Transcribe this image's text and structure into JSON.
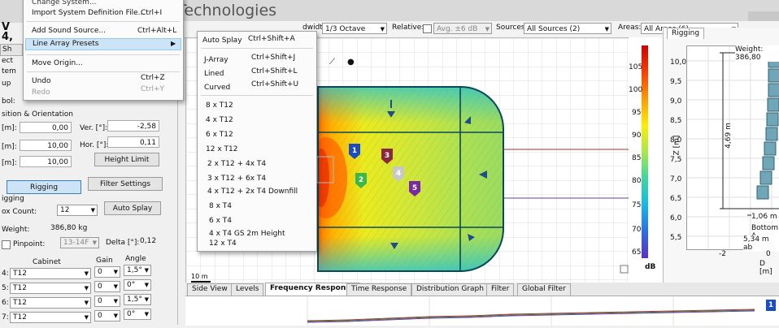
{
  "title_bar": {
    "app_title": "Technologies"
  },
  "toolbar": {
    "bandwidth_label": "dwidth:",
    "bandwidth_value": "1/3 Octave",
    "relative_label": "Relative:",
    "avg_value": "Avg. ±6 dB",
    "sources_label": "Sources:",
    "sources_value": "All Sources (2)",
    "areas_label": "Areas:",
    "areas_value": "All Areas (6)"
  },
  "file_menu": {
    "items": [
      {
        "label": "Change System...",
        "shortcut": ""
      },
      {
        "label": "Import System Definition File...",
        "shortcut": "Ctrl+I"
      },
      {
        "label": "Add Sound Source...",
        "shortcut": "Ctrl+Alt+L"
      },
      {
        "label": "Line Array Presets",
        "shortcut": ""
      },
      {
        "label": "Move Origin...",
        "shortcut": ""
      },
      {
        "label": "Undo",
        "shortcut": "Ctrl+Z"
      },
      {
        "label": "Redo",
        "shortcut": "Ctrl+Y"
      }
    ]
  },
  "presets_menu": {
    "shortcut_items": [
      {
        "label": "Auto Splay",
        "shortcut": "Ctrl+Shift+A"
      },
      {
        "label": "J-Array",
        "shortcut": "Ctrl+Shift+J"
      },
      {
        "label": "Lined",
        "shortcut": "Ctrl+Shift+L"
      },
      {
        "label": "Curved",
        "shortcut": "Ctrl+Shift+U"
      }
    ],
    "presets": [
      "8 x T12",
      "4 x T12",
      "6 x T12",
      "12 x T12",
      "2 x T12 + 4x T4",
      "3 x T12 + 6x T4",
      "4 x T12 + 2x T4 Downfill",
      "8 x T4",
      "6 x T4",
      "4 x T4 GS 2m Height",
      "12 x T4"
    ]
  },
  "left_panel": {
    "header_top": "V",
    "header_bottom": "4,",
    "tab_fragment": "Sh",
    "side_letters": [
      "ect",
      "tem",
      "up",
      "bol:"
    ],
    "section_title": "sition & Orientation",
    "rows": [
      {
        "label": "[m]:",
        "value": "0,00",
        "label2": "Ver. [°]:",
        "value2": "-2,58"
      },
      {
        "label": "[m]:",
        "value": "10,00",
        "label2": "Hor. [°]:",
        "value2": "0,11"
      },
      {
        "label": "[m]:",
        "value": "10,00",
        "button": "Height Limit"
      }
    ],
    "rigging_button": "Rigging",
    "filter_button": "Filter Settings",
    "rigging_section": "igging",
    "box_count_label": "ox Count:",
    "box_count_value": "12",
    "auto_splay_button": "Auto Splay",
    "weight_label": "Weight:",
    "weight_value": "386,80 kg",
    "pinpoint_label": "Pinpoint:",
    "pinpoint_value": "13-14F",
    "delta_label": "Delta [°]:",
    "delta_value": "0,12",
    "table_headers": [
      "Cabinet",
      "Gain",
      "Angle"
    ],
    "table_rows": [
      {
        "idx": "4:",
        "cabinet": "T12",
        "gain": "0",
        "angle": "1,5°"
      },
      {
        "idx": "5:",
        "cabinet": "T12",
        "gain": "0",
        "angle": "0°"
      },
      {
        "idx": "6:",
        "cabinet": "T12",
        "gain": "0",
        "angle": "1,5°"
      },
      {
        "idx": "7:",
        "cabinet": "T12",
        "gain": "0",
        "angle": "0°"
      }
    ]
  },
  "plot": {
    "scale_label": "10 m",
    "source_markers": [
      "1",
      "2",
      "3",
      "4",
      "5"
    ]
  },
  "colorbar": {
    "ticks": [
      "105",
      "100",
      "95",
      "90",
      "85",
      "80",
      "75",
      "70",
      "65"
    ],
    "unit": "dB",
    "gradient": [
      "#d00000",
      "#ff3b00",
      "#ff9900",
      "#ffee00",
      "#a8e84a",
      "#3cd8a0",
      "#15b8e8",
      "#2a6ee8",
      "#5a2fc8"
    ]
  },
  "rigging_panel": {
    "tab_label": "Rigging",
    "weight_text": "Weight: 386,80",
    "z_axis_label": "Z [m]",
    "y_ticks": [
      "10,0",
      "9,5",
      "9,0",
      "8,5",
      "8,0",
      "7,5",
      "7,0",
      "6,5",
      "6,0",
      "5,5"
    ],
    "x_ticks": [
      "-2",
      "0"
    ],
    "x_axis_label": "D [m]",
    "height_dim": "4,69 m",
    "depth_dim": "1,06 m",
    "bottom_text": "Bottom A",
    "lower_text": "5,34 m ab"
  },
  "tabs": [
    {
      "label": "Side View",
      "active": false
    },
    {
      "label": "Levels",
      "active": false
    },
    {
      "label": "Frequency Response",
      "active": true
    },
    {
      "label": "Time Response",
      "active": false
    },
    {
      "label": "Distribution Graph",
      "active": false
    },
    {
      "label": "Filter",
      "active": false
    },
    {
      "label": "Global Filter",
      "active": false
    }
  ],
  "bottom_marker": "1"
}
